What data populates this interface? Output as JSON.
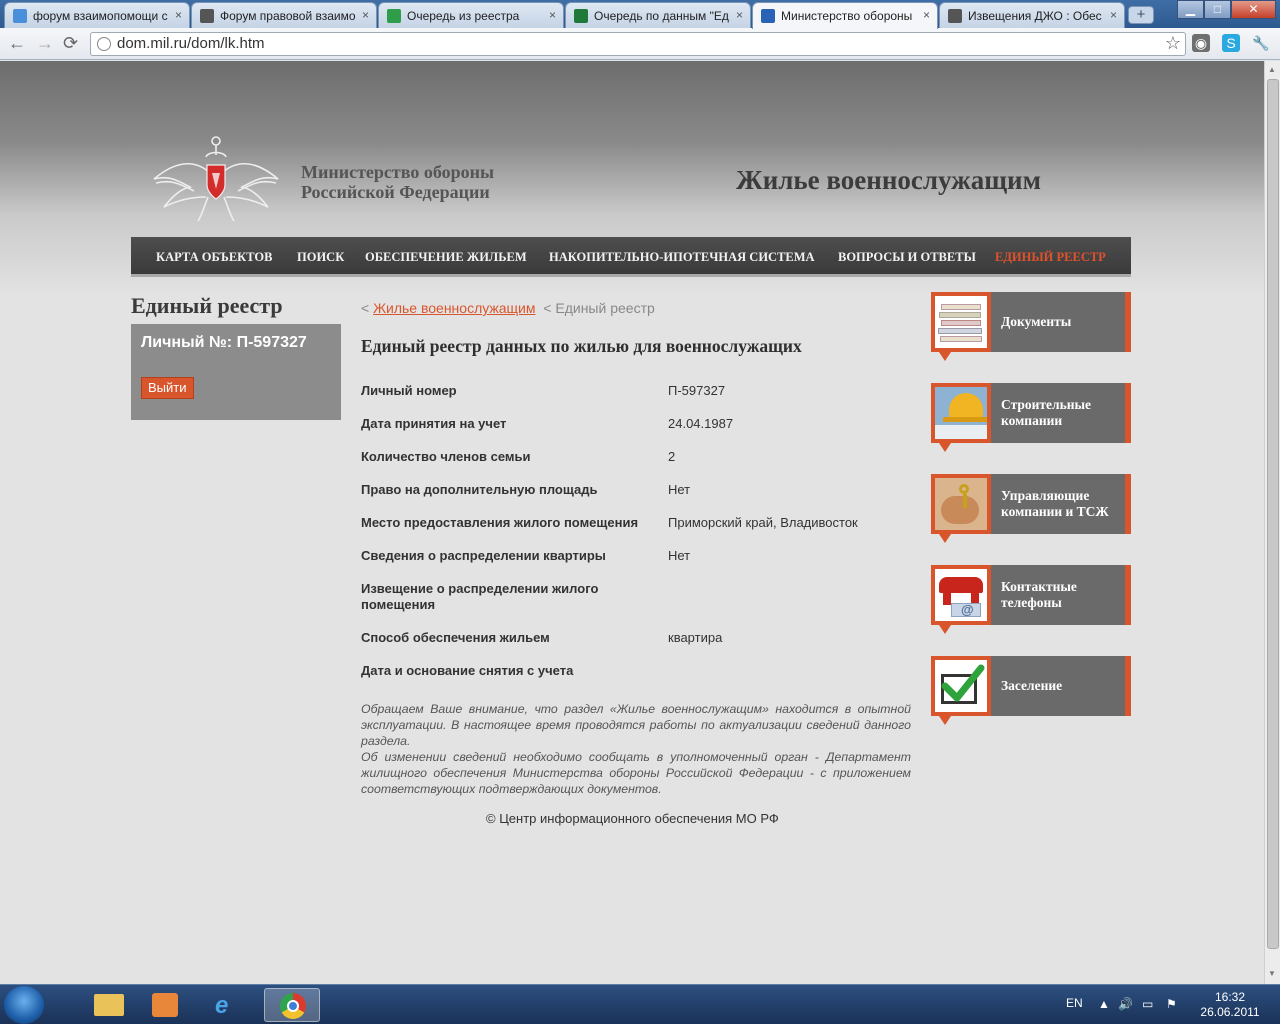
{
  "browser": {
    "tabs": [
      {
        "title": "форум взаимопомощи с",
        "active": false,
        "favicon_color": "#4a8fd9"
      },
      {
        "title": "Форум правовой взаимо",
        "active": false,
        "favicon_color": "#555555"
      },
      {
        "title": "Очередь из реестра",
        "active": false,
        "favicon_color": "#2e9e4a"
      },
      {
        "title": "Очередь по данным \"Ед",
        "active": false,
        "favicon_color": "#1f7a3a"
      },
      {
        "title": "Министерство обороны",
        "active": true,
        "favicon_color": "#2a62b8"
      },
      {
        "title": "Извещения ДЖО : Обес",
        "active": false,
        "favicon_color": "#555555"
      }
    ],
    "tab_close_glyph": "×",
    "new_tab_glyph": "+",
    "url": "dom.mil.ru/dom/lk.htm"
  },
  "site": {
    "ministry_line1": "Министерство обороны",
    "ministry_line2": "Российской Федерации",
    "title": "Жилье военнослужащим",
    "menu": [
      {
        "label": "КАРТА ОБЪЕКТОВ",
        "active": false
      },
      {
        "label": "ПОИСК",
        "active": false
      },
      {
        "label": "ОБЕСПЕЧЕНИЕ ЖИЛЬЕМ",
        "active": false
      },
      {
        "label": "НАКОПИТЕЛЬНО-ИПОТЕЧНАЯ СИСТЕМА",
        "active": false
      },
      {
        "label": "ВОПРОСЫ И ОТВЕТЫ",
        "active": false
      },
      {
        "label": "ЕДИНЫЙ РЕЕСТР",
        "active": true
      }
    ],
    "accent_color": "#d9552c"
  },
  "left": {
    "title": "Единый реестр",
    "personal_number": "Личный №: П-597327",
    "logout_label": "Выйти"
  },
  "breadcrumbs": {
    "sep": "<",
    "link": "Жилье военнослужащим",
    "current": "Единый реестр"
  },
  "main": {
    "title": "Единый реестр данных по жилью для военнослужащих",
    "rows": [
      {
        "label": "Личный номер",
        "value": "П-597327"
      },
      {
        "label": "Дата принятия на учет",
        "value": "24.04.1987"
      },
      {
        "label": "Количество членов семьи",
        "value": "2"
      },
      {
        "label": "Право на дополнительную площадь",
        "value": "Нет"
      },
      {
        "label": "Место предоставления жилого помещения",
        "value": "Приморский край, Владивосток"
      },
      {
        "label": "Сведения о распределении квартиры",
        "value": "Нет"
      },
      {
        "label": "Извещение о распределении жилого помещения",
        "value": ""
      },
      {
        "label": "Способ обеспечения жильем",
        "value": "квартира"
      },
      {
        "label": "Дата и основание снятия с учета",
        "value": ""
      }
    ],
    "notice_p1": "Обращаем Ваше внимание, что раздел «Жилье военнослужащим» находится в опытной эксплуатации. В настоящее время проводятся работы по актуализации сведений данного раздела.",
    "notice_p2": "Об изменении сведений необходимо сообщать в уполномоченный орган - Департамент жилищного обеспечения Министерства обороны Российской Федерации - с приложением соответствующих подтверждающих документов.",
    "copyright": "© Центр информационного обеспечения МО РФ"
  },
  "sidebar": [
    {
      "label": "Документы",
      "icon": "documents-icon"
    },
    {
      "label": "Строительные компании",
      "icon": "construction-helmet-icon"
    },
    {
      "label": "Управляющие компании и ТСЖ",
      "icon": "keys-hand-icon"
    },
    {
      "label": "Контактные телефоны",
      "icon": "phone-icon"
    },
    {
      "label": "Заселение",
      "icon": "checkmark-icon"
    }
  ],
  "taskbar": {
    "lang": "EN",
    "time": "16:32",
    "date": "26.06.2011"
  }
}
